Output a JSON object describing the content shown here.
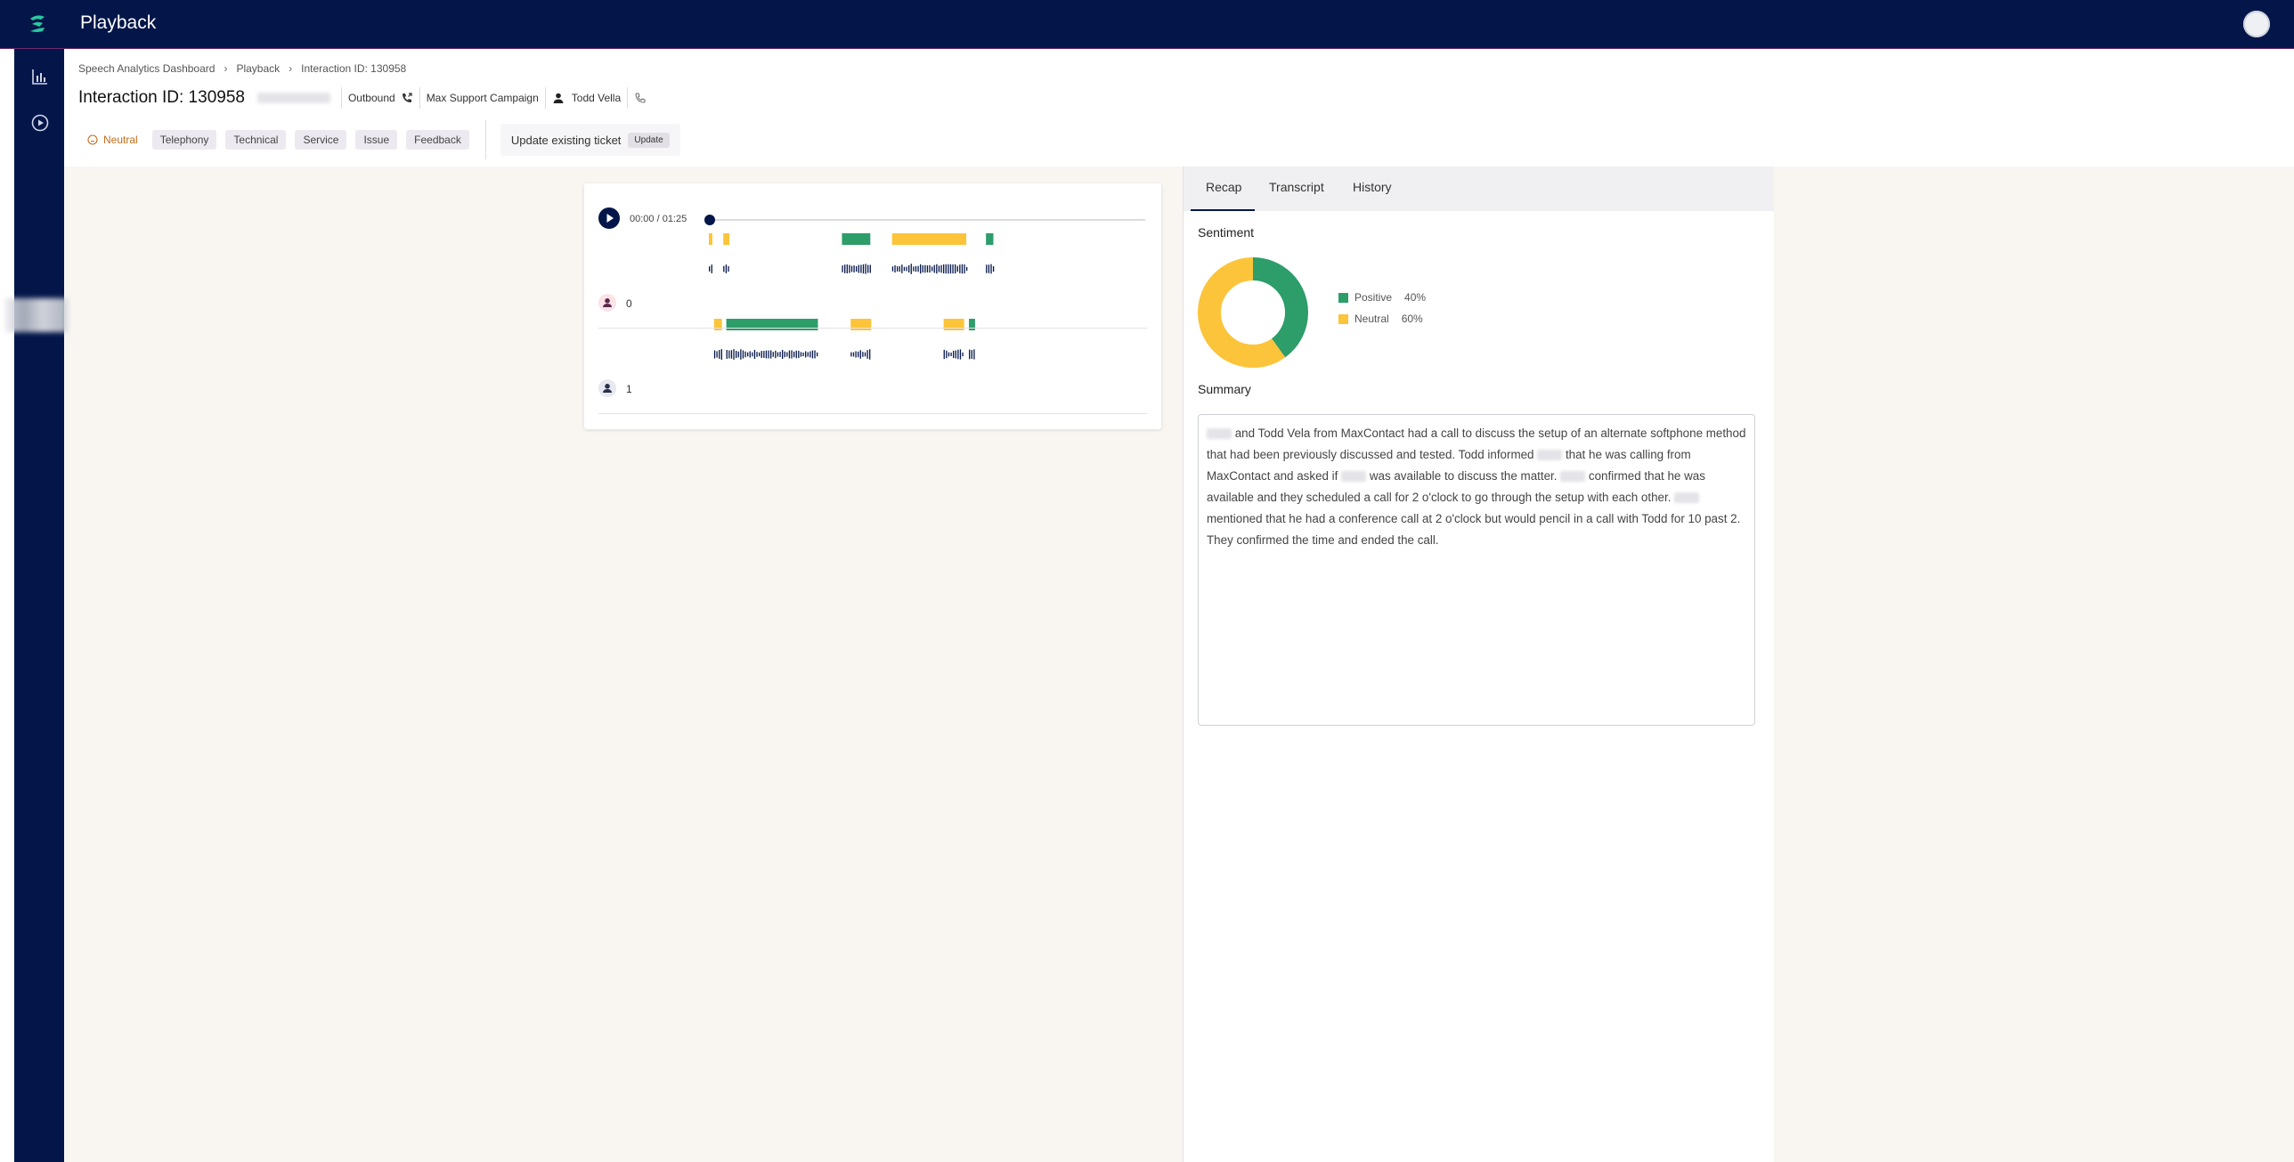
{
  "app": {
    "title": "Playback"
  },
  "colors": {
    "navy": "#041649",
    "positive": "#2d9d6a",
    "neutral": "#fbc43a",
    "neutral_text": "#c26d1b"
  },
  "sidebar": {
    "items": [
      {
        "icon": "bar-chart-icon"
      },
      {
        "icon": "play-circle-icon"
      }
    ]
  },
  "breadcrumb": [
    "Speech Analytics Dashboard",
    "Playback",
    "Interaction ID: 130958"
  ],
  "interaction": {
    "title": "Interaction ID: 130958",
    "direction": "Outbound",
    "campaign": "Max Support Campaign",
    "agent": "Todd Vella"
  },
  "tags": {
    "sentiment": "Neutral",
    "chips": [
      "Telephony",
      "Technical",
      "Service",
      "Issue",
      "Feedback"
    ]
  },
  "ticket": {
    "label": "Update existing ticket",
    "button": "Update"
  },
  "player": {
    "timecode": "00:00 / 01:25",
    "duration_sec": 85,
    "position_fraction": 0,
    "speakers": [
      {
        "label": "0",
        "segments": [
          {
            "start": 0.0,
            "end": 0.008,
            "sentiment": "neutral"
          },
          {
            "start": 0.033,
            "end": 0.047,
            "sentiment": "neutral"
          },
          {
            "start": 0.305,
            "end": 0.37,
            "sentiment": "positive"
          },
          {
            "start": 0.42,
            "end": 0.59,
            "sentiment": "neutral"
          },
          {
            "start": 0.635,
            "end": 0.652,
            "sentiment": "positive"
          }
        ]
      },
      {
        "label": "1",
        "segments": [
          {
            "start": 0.012,
            "end": 0.03,
            "sentiment": "neutral"
          },
          {
            "start": 0.04,
            "end": 0.25,
            "sentiment": "positive"
          },
          {
            "start": 0.325,
            "end": 0.372,
            "sentiment": "neutral"
          },
          {
            "start": 0.538,
            "end": 0.585,
            "sentiment": "neutral"
          },
          {
            "start": 0.596,
            "end": 0.61,
            "sentiment": "positive"
          }
        ]
      }
    ]
  },
  "tabs": [
    "Recap",
    "Transcript",
    "History"
  ],
  "recap": {
    "sentiment_label": "Sentiment",
    "summary_label": "Summary",
    "sentiment": [
      {
        "name": "Positive",
        "value": 40,
        "label": "40%"
      },
      {
        "name": "Neutral",
        "value": 60,
        "label": "60%"
      }
    ],
    "summary_parts": [
      {
        "redacted": true
      },
      {
        "text": " and Todd Vela from MaxContact had a call to discuss the setup of an alternate softphone method that had been previously discussed and tested. Todd informed "
      },
      {
        "redacted": true
      },
      {
        "text": " that he was calling from MaxContact and asked if "
      },
      {
        "redacted": true
      },
      {
        "text": " was available to discuss the matter. "
      },
      {
        "redacted": true
      },
      {
        "text": " confirmed that he was available and they scheduled a call for 2 o'clock to go through the setup with each other. "
      },
      {
        "redacted": true
      },
      {
        "text": " mentioned that he had a conference call at 2 o'clock but would pencil in a call with Todd for 10 past 2. They confirmed the time and ended the call."
      }
    ]
  }
}
